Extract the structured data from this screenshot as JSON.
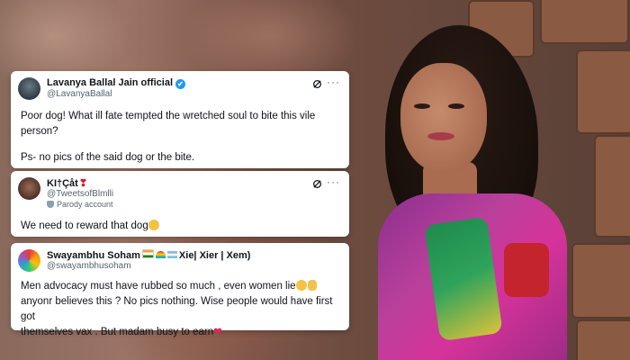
{
  "tweets": [
    {
      "name": "Lavanya Ballal Jain official",
      "handle": "@LavanyaBallal",
      "verified_badge": "✔",
      "body": "Poor dog! What ill fate tempted the wretched soul to bite this vile person?",
      "ps": "Ps- no pics of the said dog or the bite."
    },
    {
      "name": "KI†Çåt",
      "name_emoji": "❣",
      "handle": "@TweetsofBlmlli",
      "parody_label": "Parody account",
      "body": "We need to reward that dog"
    },
    {
      "name": "Swayambhu Soham",
      "pronouns": "Xie| Xier | Xem)",
      "handle": "@swayambhusoham",
      "body_line1": "Men advocacy must have rubbed so much , even women lie",
      "body_line2": "anyonr believes this ? No pics nothing. Wise people would have first got",
      "body_line3": "themselves vax . But madam busy to earn",
      "heart": "❤"
    }
  ],
  "more_glyph": "···",
  "icons": {
    "grok": "grok-icon",
    "more": "more-options-icon"
  },
  "colors": {
    "verified": "#1d9bf0",
    "heart": "#e0245e",
    "text": "#0f1419",
    "muted": "#536471"
  }
}
